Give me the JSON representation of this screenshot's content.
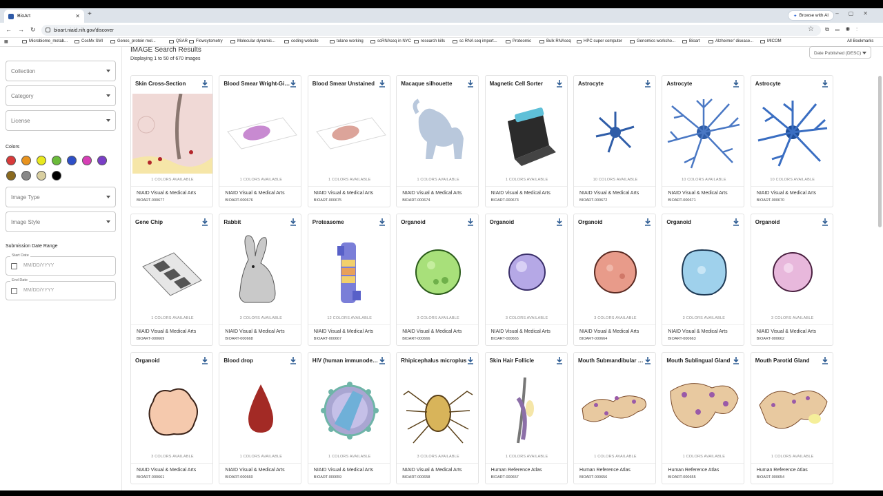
{
  "browser": {
    "tab_title": "BioArt",
    "new_tab": "+",
    "browse_ai": "Browse with AI",
    "url": "bioart.niaid.nih.gov/discover",
    "all_bookmarks": "All Bookmarks",
    "bookmarks": [
      "Microbiome_metab...",
      "CosMx SMI",
      "Genes_protein mol...",
      "QSAR",
      "Flowcytometry",
      "Molecular dynamic...",
      "coding website",
      "tulane working",
      "scRNAseq in NYC",
      "research kills",
      "sc RNA seq import...",
      "Proteomic",
      "Bulk RNAseq",
      "HPC super computer",
      "Genomics worksho...",
      "Bioart",
      "Alzheimer' disease...",
      "MICOM"
    ]
  },
  "sidebar": {
    "filters": [
      "Collection",
      "Category",
      "License"
    ],
    "colors_label": "Colors",
    "swatch_colors": [
      "#d93a3a",
      "#e8931f",
      "#e8e81e",
      "#6bbb3a",
      "#2e4fc7",
      "#d63fb5",
      "#7a3fc7",
      "#8a6a1e",
      "#888888",
      "#d9cfa0",
      "#000000"
    ],
    "filters2": [
      "Image Type",
      "Image Style"
    ],
    "date_range_label": "Submission Date Range",
    "start_date_label": "Start Date",
    "end_date_label": "End Date",
    "date_placeholder": "MM/DD/YYYY"
  },
  "main": {
    "title": "IMAGE Search Results",
    "count": "Displaying 1 to 50 of 670 images",
    "sort": "Date Published (DESC)"
  },
  "cards": [
    {
      "title": "Skin Cross-Section",
      "colors": "1 COLORS AVAILABLE",
      "source": "NIAID Visual & Medical Arts",
      "id": "BIOART-000677"
    },
    {
      "title": "Blood Smear Wright-Giemsa",
      "colors": "1 COLORS AVAILABLE",
      "source": "NIAID Visual & Medical Arts",
      "id": "BIOART-000676"
    },
    {
      "title": "Blood Smear Unstained",
      "colors": "1 COLORS AVAILABLE",
      "source": "NIAID Visual & Medical Arts",
      "id": "BIOART-000675"
    },
    {
      "title": "Macaque silhouette",
      "colors": "1 COLORS AVAILABLE",
      "source": "NIAID Visual & Medical Arts",
      "id": "BIOART-000674"
    },
    {
      "title": "Magnetic Cell Sorter",
      "colors": "1 COLORS AVAILABLE",
      "source": "NIAID Visual & Medical Arts",
      "id": "BIOART-000673"
    },
    {
      "title": "Astrocyte",
      "colors": "10 COLORS AVAILABLE",
      "source": "NIAID Visual & Medical Arts",
      "id": "BIOART-000672"
    },
    {
      "title": "Astrocyte",
      "colors": "10 COLORS AVAILABLE",
      "source": "NIAID Visual & Medical Arts",
      "id": "BIOART-000671"
    },
    {
      "title": "Astrocyte",
      "colors": "10 COLORS AVAILABLE",
      "source": "NIAID Visual & Medical Arts",
      "id": "BIOART-000670"
    },
    {
      "title": "Gene Chip",
      "colors": "1 COLORS AVAILABLE",
      "source": "NIAID Visual & Medical Arts",
      "id": "BIOART-000669"
    },
    {
      "title": "Rabbit",
      "colors": "3 COLORS AVAILABLE",
      "source": "NIAID Visual & Medical Arts",
      "id": "BIOART-000668"
    },
    {
      "title": "Proteasome",
      "colors": "12 COLORS AVAILABLE",
      "source": "NIAID Visual & Medical Arts",
      "id": "BIOART-000667"
    },
    {
      "title": "Organoid",
      "colors": "3 COLORS AVAILABLE",
      "source": "NIAID Visual & Medical Arts",
      "id": "BIOART-000666"
    },
    {
      "title": "Organoid",
      "colors": "3 COLORS AVAILABLE",
      "source": "NIAID Visual & Medical Arts",
      "id": "BIOART-000665"
    },
    {
      "title": "Organoid",
      "colors": "3 COLORS AVAILABLE",
      "source": "NIAID Visual & Medical Arts",
      "id": "BIOART-000664"
    },
    {
      "title": "Organoid",
      "colors": "3 COLORS AVAILABLE",
      "source": "NIAID Visual & Medical Arts",
      "id": "BIOART-000663"
    },
    {
      "title": "Organoid",
      "colors": "3 COLORS AVAILABLE",
      "source": "NIAID Visual & Medical Arts",
      "id": "BIOART-000662"
    },
    {
      "title": "Organoid",
      "colors": "3 COLORS AVAILABLE",
      "source": "NIAID Visual & Medical Arts",
      "id": "BIOART-000661"
    },
    {
      "title": "Blood drop",
      "colors": "1 COLORS AVAILABLE",
      "source": "NIAID Visual & Medical Arts",
      "id": "BIOART-000660"
    },
    {
      "title": "HIV (human immunodeficiency virus)",
      "colors": "1 COLORS AVAILABLE",
      "source": "NIAID Visual & Medical Arts",
      "id": "BIOART-000659"
    },
    {
      "title": "Rhipicephalus microplus",
      "colors": "3 COLORS AVAILABLE",
      "source": "NIAID Visual & Medical Arts",
      "id": "BIOART-000658"
    },
    {
      "title": "Skin Hair Follicle",
      "colors": "1 COLORS AVAILABLE",
      "source": "Human Reference Atlas",
      "id": "BIOART-000657"
    },
    {
      "title": "Mouth Submandibular Gland",
      "colors": "1 COLORS AVAILABLE",
      "source": "Human Reference Atlas",
      "id": "BIOART-000656"
    },
    {
      "title": "Mouth Sublingual Gland",
      "colors": "1 COLORS AVAILABLE",
      "source": "Human Reference Atlas",
      "id": "BIOART-000655"
    },
    {
      "title": "Mouth Parotid Gland",
      "colors": "1 COLORS AVAILABLE",
      "source": "Human Reference Atlas",
      "id": "BIOART-000654"
    }
  ]
}
